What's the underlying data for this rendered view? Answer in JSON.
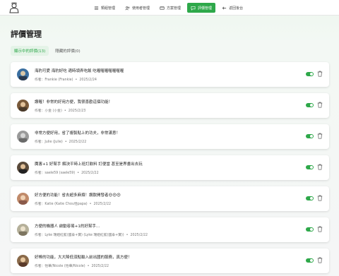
{
  "header": {
    "logo_icon": "person-avatar-icon",
    "nav": [
      {
        "label": "類組管理",
        "icon": "list-icon",
        "active": false
      },
      {
        "label": "使用者管理",
        "icon": "users-icon",
        "active": false
      },
      {
        "label": "方案管理",
        "icon": "card-icon",
        "active": false
      },
      {
        "label": "評價管理",
        "icon": "chat-icon",
        "active": true
      },
      {
        "label": "返回後台",
        "icon": "arrow-left-icon",
        "active": false
      }
    ]
  },
  "page": {
    "title": "評價管理",
    "tabs": [
      {
        "label": "顯示中的評價(13)",
        "active": true
      },
      {
        "label": "隱藏的評價(0)",
        "active": false
      }
    ]
  },
  "colors": {
    "accent": "#2ea84a"
  },
  "reviews": [
    {
      "text": "海豹可愛 海豹好吃 適時領弄吃飯 吃喔喔喔喔喔喔喔",
      "author": "作者：Frankie (Frankie)",
      "date": "2025/2/24",
      "visible": true,
      "avatar_color": "#3b6fa0"
    },
    {
      "text": "讚喔！非常的好用方便，我很喜歡這個功能！",
      "author": "作者：小金 (小金)",
      "date": "2025/2/23",
      "visible": true,
      "avatar_color": "#7a5a3a"
    },
    {
      "text": "非常方便好用，省了複製貼上的功夫，非常滿意！",
      "author": "作者：Julie (Julie)",
      "date": "2025/2/22",
      "visible": true,
      "avatar_color": "#9a9a9a"
    },
    {
      "text": "厲害+1 好幫手 解決平時上班訂飲料 訂便當 甚至是界畫出去玩",
      "author": "作者：saele59 (saele59)",
      "date": "2025/2/22",
      "visible": true,
      "avatar_color": "#5a4a3a"
    },
    {
      "text": "好方便的功能！省去超多麻煩！讚歎開發者😍😍😍",
      "author": "作者：Katie (Katie Chou恰papa)",
      "date": "2025/2/22",
      "visible": true,
      "avatar_color": "#c08a6a"
    },
    {
      "text": "方便的機器人 啟動容易+1的好幫手...",
      "author": "作者：Lyke 瑞姐紅藍(國泰+寶) (Lyke 瑞姐紅藍(國泰+寶))",
      "date": "2025/2/22",
      "visible": true,
      "avatar_color": "#b5b09a"
    },
    {
      "text": "好棒的功能，大大降低須點輸入前出國的服務，真方便！",
      "author": "作者：怡華/Nicole (怡華/Nicole)",
      "date": "2025/2/22",
      "visible": true,
      "avatar_color": "#8a6a4a"
    }
  ]
}
